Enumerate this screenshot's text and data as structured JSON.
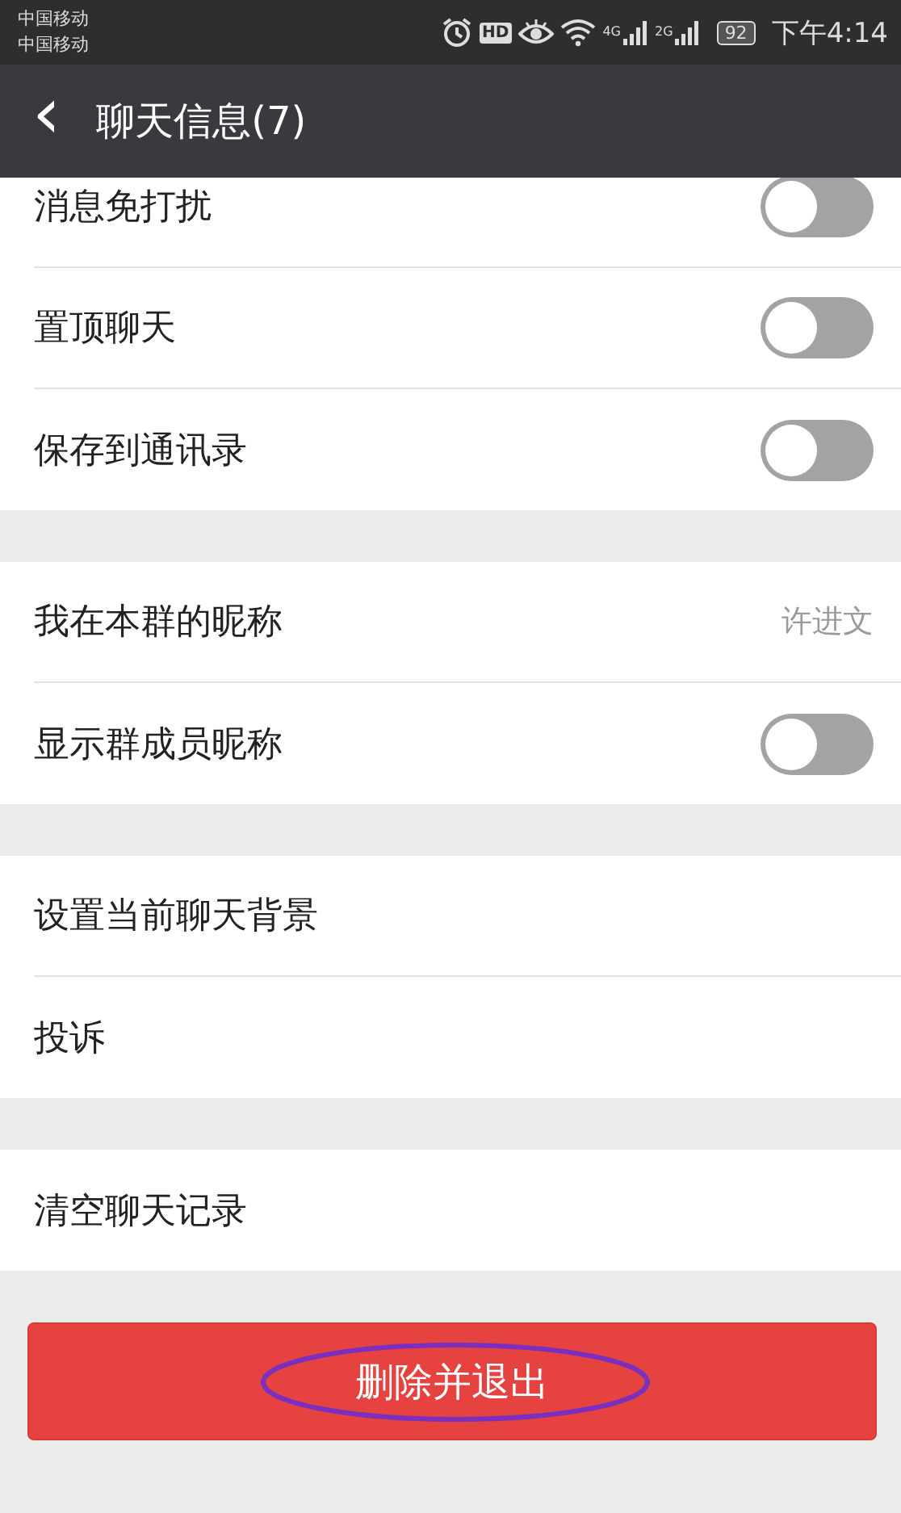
{
  "status_bar": {
    "carriers": [
      "中国移动",
      "中国移动"
    ],
    "hd": "HD",
    "net_1": "4G",
    "net_2": "2G",
    "battery": "92",
    "time": "下午4:14"
  },
  "header": {
    "back": "‹",
    "title": "聊天信息(7)"
  },
  "groups": [
    {
      "items": [
        {
          "kind": "toggle",
          "label": "消息免打扰",
          "on": false
        },
        {
          "kind": "toggle",
          "label": "置顶聊天",
          "on": false
        },
        {
          "kind": "toggle",
          "label": "保存到通讯录",
          "on": false
        }
      ]
    },
    {
      "items": [
        {
          "kind": "value",
          "label": "我在本群的昵称",
          "value": "许进文"
        },
        {
          "kind": "toggle",
          "label": "显示群成员昵称",
          "on": false
        }
      ]
    },
    {
      "items": [
        {
          "kind": "plain",
          "label": "设置当前聊天背景"
        },
        {
          "kind": "plain",
          "label": "投诉"
        }
      ]
    },
    {
      "items": [
        {
          "kind": "plain",
          "label": "清空聊天记录"
        }
      ]
    }
  ],
  "exit_button": {
    "label": "删除并退出",
    "highlighted": true
  }
}
